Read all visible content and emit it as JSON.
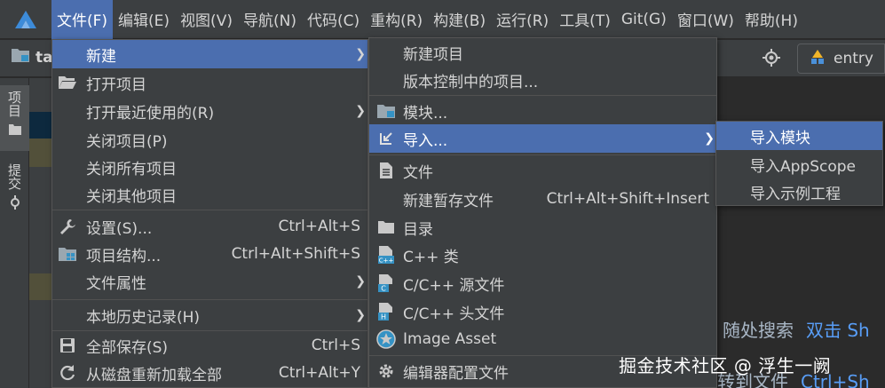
{
  "menubar": {
    "items": [
      "文件(F)",
      "编辑(E)",
      "视图(V)",
      "导航(N)",
      "代码(C)",
      "重构(R)",
      "构建(B)",
      "运行(R)",
      "工具(T)",
      "Git(G)",
      "窗口(W)",
      "帮助(H)"
    ],
    "active_index": 0
  },
  "toolbar": {
    "project_label": "ta",
    "run_config": "entry"
  },
  "side_strip": {
    "project_tab": "项目",
    "commit_tab": "提交"
  },
  "file_menu": {
    "new": "新建",
    "open_project": "打开项目",
    "open_recent": "打开最近使用的(R)",
    "close_project": "关闭项目(P)",
    "close_all": "关闭所有项目",
    "close_others": "关闭其他项目",
    "settings": "设置(S)...",
    "settings_shortcut": "Ctrl+Alt+S",
    "project_structure": "项目结构...",
    "project_structure_shortcut": "Ctrl+Alt+Shift+S",
    "file_properties": "文件属性",
    "local_history": "本地历史记录(H)",
    "save_all": "全部保存(S)",
    "save_all_shortcut": "Ctrl+S",
    "reload_all": "从磁盘重新加载全部",
    "reload_all_shortcut": "Ctrl+Alt+Y"
  },
  "new_menu": {
    "new_project": "新建项目",
    "project_from_vcs": "版本控制中的项目...",
    "module": "模块...",
    "import": "导入...",
    "file": "文件",
    "scratch_file": "新建暂存文件",
    "scratch_file_shortcut": "Ctrl+Alt+Shift+Insert",
    "directory": "目录",
    "cpp_class": "C++ 类",
    "cpp_source": "C/C++ 源文件",
    "cpp_header": "C/C++ 头文件",
    "image_asset": "Image Asset",
    "editor_config": "编辑器配置文件"
  },
  "import_menu": {
    "import_module": "导入模块",
    "import_appscope": "导入AppScope",
    "import_sample": "导入示例工程"
  },
  "editor_hints": {
    "search_everywhere": "随处搜索",
    "search_everywhere_key": "双击 Sh",
    "goto_file": "转到文件",
    "goto_file_key": "Ctrl+Sh"
  },
  "watermark": "掘金技术社区 @ 浮生一阙",
  "colors": {
    "highlight": "#4b6eaf",
    "menu_bg": "#3c3f41",
    "editor_bg": "#2b2b2b",
    "hint_key": "#589df6"
  }
}
